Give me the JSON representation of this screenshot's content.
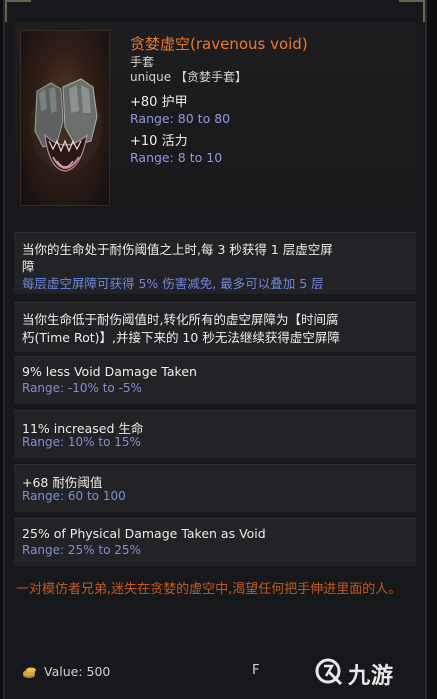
{
  "item": {
    "name": "贪婪虚空(ravenous void)",
    "type": "手套",
    "rarity": "unique 【贪婪手套】",
    "icon": "gauntlet-icon"
  },
  "base_stats": [
    {
      "stat": "+80 护甲",
      "range": "Range: 80 to 80"
    },
    {
      "stat": "+10 活力",
      "range": "Range: 8 to 10"
    }
  ],
  "affixes": [
    {
      "line1": "当你的生命处于耐伤阈值之上时,每 3 秒获得 1 层虚空屏",
      "line2": "障",
      "note": "每层虚空屏障可获得 5% 伤害减免, 最多可以叠加 5 层"
    },
    {
      "line1": "当你生命低于耐伤阈值时,转化所有的虚空屏障为【时间腐",
      "line2": "朽(Time Rot)】,并接下来的 10 秒无法继续获得虚空屏障"
    },
    {
      "stat": "9% less Void Damage Taken",
      "range": "Range: -10% to -5%"
    },
    {
      "stat": "11% increased 生命",
      "range": "Range: 10% to 15%"
    },
    {
      "stat": "+68 耐伤阈值",
      "range": "Range: 60 to 100"
    },
    {
      "stat": "25% of Physical Damage Taken as Void",
      "range": "Range: 25% to 25%"
    }
  ],
  "lore": "一对模仿者兄弟,迷失在贪婪的虚空中,渴望任何把手伸进里面的人。",
  "footer": {
    "value": "Value: 500",
    "f_label": "F",
    "coin_icon": "coin-icon"
  },
  "watermark": {
    "text": "九游",
    "icon": "jiuyou-logo-icon"
  }
}
